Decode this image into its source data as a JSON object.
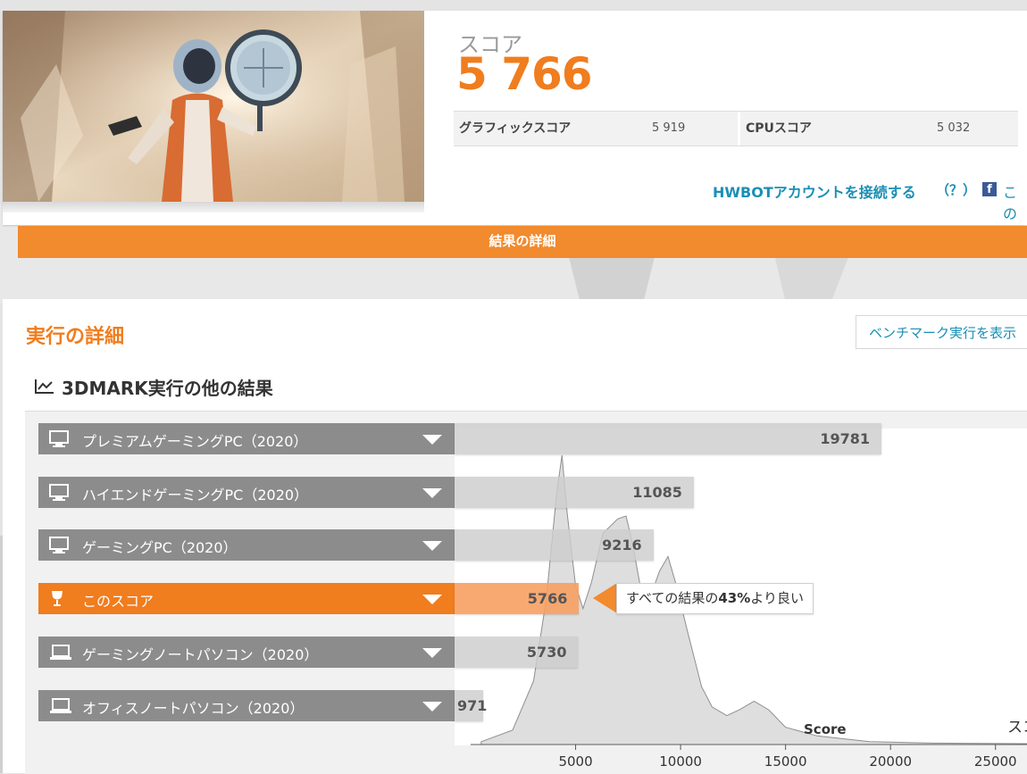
{
  "score": {
    "label": "スコア",
    "value": "5 766"
  },
  "subscores": [
    {
      "name": "グラフィックスコア",
      "value": "5 919"
    },
    {
      "name": "CPUスコア",
      "value": "5 032"
    }
  ],
  "hwbot": {
    "link": "HWBOTアカウントを接続する",
    "help": "（？）",
    "facebook_text": "この"
  },
  "details_bar": "結果の詳細",
  "run_details": {
    "title": "実行の詳細",
    "show_button": "ベンチマーク実行を表示"
  },
  "comparison": {
    "title": "3DMARK実行の他の結果",
    "rows": [
      {
        "label": "プレミアムゲーミングPC（2020）",
        "value": "19781",
        "icon": "desktop-icon"
      },
      {
        "label": "ハイエンドゲーミングPC（2020）",
        "value": "11085",
        "icon": "desktop-icon"
      },
      {
        "label": "ゲーミングPC（2020）",
        "value": "9216",
        "icon": "desktop-icon"
      },
      {
        "label": "このスコア",
        "value": "5766",
        "icon": "trophy-icon"
      },
      {
        "label": "ゲーミングノートパソコン（2020）",
        "value": "5730",
        "icon": "laptop-icon"
      },
      {
        "label": "オフィスノートパソコン（2020）",
        "value": "971",
        "icon": "laptop-icon"
      }
    ],
    "tooltip": {
      "prefix": "すべての結果の",
      "percent": "43%",
      "suffix": "より良い"
    }
  },
  "chart_data": {
    "type": "area",
    "xlabel": "Score",
    "ylabel": "スコ",
    "x_ticks": [
      5000,
      10000,
      15000,
      20000,
      25000
    ],
    "xlim": [
      0,
      26500
    ],
    "points": [
      [
        500,
        0.01
      ],
      [
        2000,
        0.05
      ],
      [
        3000,
        0.22
      ],
      [
        3600,
        0.5
      ],
      [
        4100,
        0.87
      ],
      [
        4350,
        1.0
      ],
      [
        4600,
        0.8
      ],
      [
        5000,
        0.55
      ],
      [
        5350,
        0.47
      ],
      [
        5750,
        0.56
      ],
      [
        6300,
        0.73
      ],
      [
        7000,
        0.78
      ],
      [
        7400,
        0.79
      ],
      [
        7700,
        0.7
      ],
      [
        8100,
        0.54
      ],
      [
        8500,
        0.5
      ],
      [
        9000,
        0.6
      ],
      [
        9400,
        0.65
      ],
      [
        9800,
        0.55
      ],
      [
        10300,
        0.4
      ],
      [
        11000,
        0.2
      ],
      [
        11500,
        0.13
      ],
      [
        12200,
        0.1
      ],
      [
        12800,
        0.12
      ],
      [
        13500,
        0.15
      ],
      [
        14200,
        0.12
      ],
      [
        15000,
        0.06
      ],
      [
        16500,
        0.03
      ],
      [
        19000,
        0.01
      ],
      [
        22000,
        0.005
      ],
      [
        26500,
        0.003
      ]
    ],
    "colors": {
      "accent": "#f07d1e",
      "fill": "#dcdcdc"
    }
  }
}
